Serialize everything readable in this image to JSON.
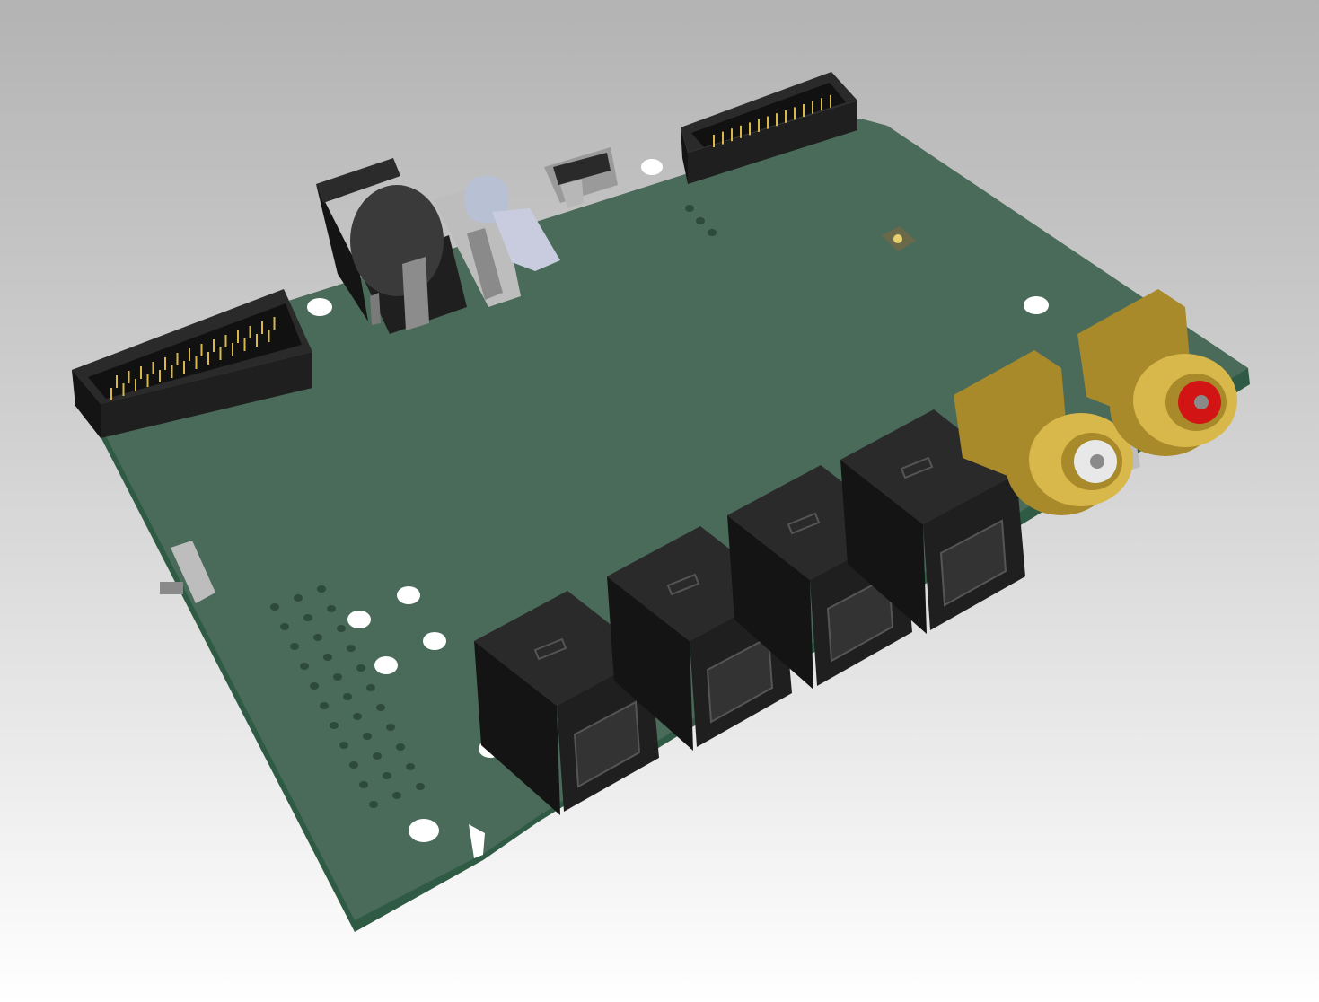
{
  "viewport": {
    "background_top": "#b3b3b3",
    "background_bottom": "#ffffff"
  },
  "colors": {
    "pcb_top": "#4a6b5a",
    "pcb_edge": "#2f5a43",
    "connector_black": "#1f1f1f",
    "connector_side": "#141414",
    "gold": "#d8b84a",
    "gold_dark": "#a88a2a",
    "rca_red": "#d21414",
    "rca_white": "#e8e8e8",
    "silver": "#bdbdbd",
    "light_blue": "#c8ccde",
    "hole": "#ffffff"
  },
  "components": {
    "optical_jacks_count": 4,
    "rca_jacks_count": 2,
    "pin_headers_count": 2
  }
}
